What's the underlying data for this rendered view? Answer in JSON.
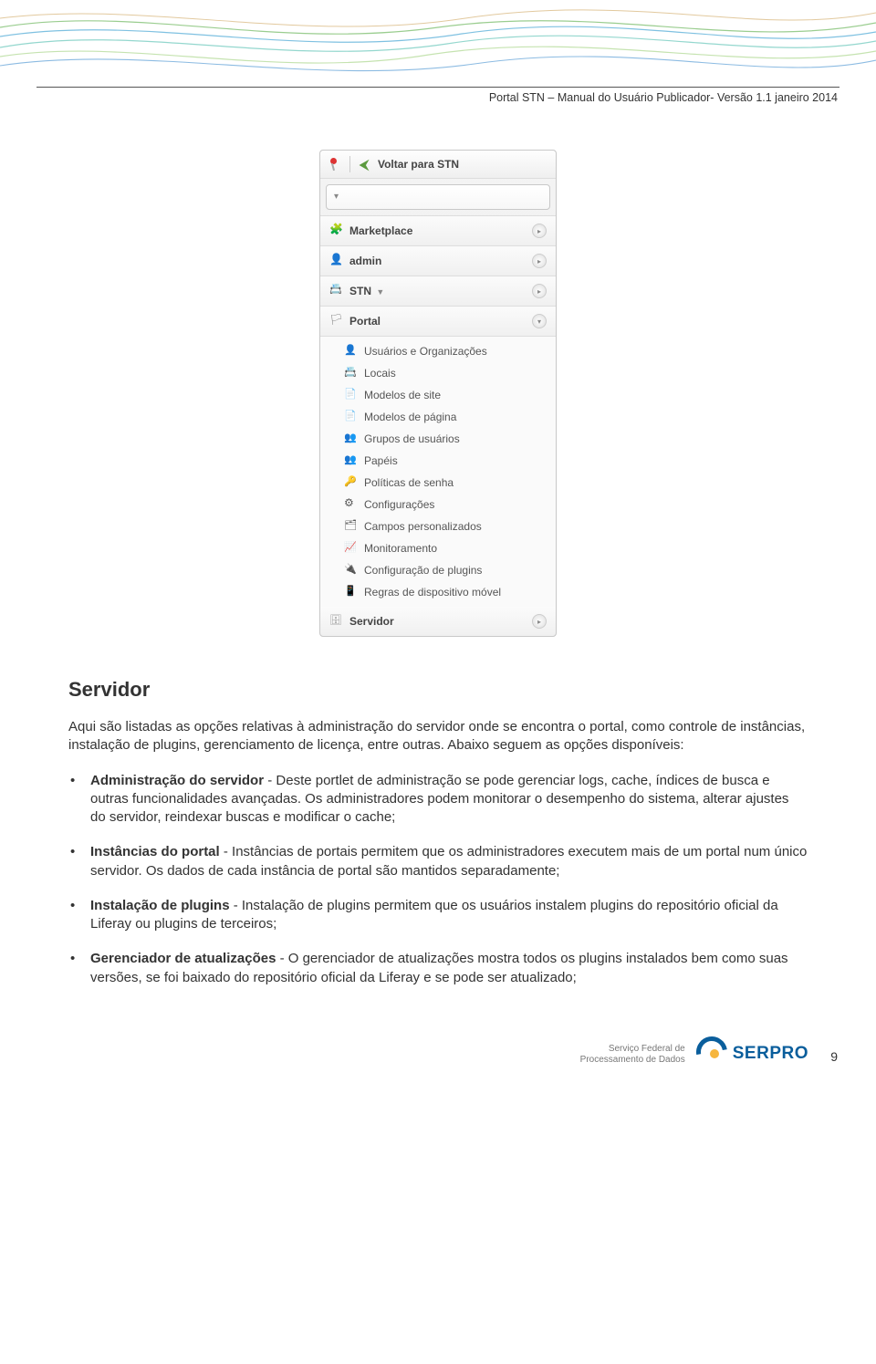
{
  "header": {
    "doc_title": "Portal STN – Manual do Usuário Publicador- Versão 1.1 janeiro 2014"
  },
  "panel": {
    "back_label": "Voltar para STN",
    "sections": {
      "marketplace": {
        "label": "Marketplace"
      },
      "admin": {
        "label": "admin"
      },
      "stn": {
        "label": "STN",
        "dropdown": "▼"
      },
      "portal": {
        "label": "Portal"
      },
      "servidor": {
        "label": "Servidor"
      }
    },
    "portal_items": [
      "Usuários e Organizações",
      "Locais",
      "Modelos de site",
      "Modelos de página",
      "Grupos de usuários",
      "Papéis",
      "Políticas de senha",
      "Configurações",
      "Campos personalizados",
      "Monitoramento",
      "Configuração de plugins",
      "Regras de dispositivo móvel"
    ]
  },
  "body": {
    "heading": "Servidor",
    "intro": "Aqui são listadas as opções relativas à administração do servidor onde se encontra o portal, como controle de instâncias, instalação de plugins, gerenciamento de licença, entre outras. Abaixo seguem as opções disponíveis:",
    "items": [
      {
        "title": "Administração do servidor",
        "text": " - Deste portlet de administração se pode gerenciar logs, cache, índices de busca e outras funcionalidades avançadas. Os administradores podem monitorar o desempenho do sistema, alterar ajustes do servidor, reindexar buscas e modificar o cache;"
      },
      {
        "title": "Instâncias do portal",
        "text": " - Instâncias de portais permitem que os administradores executem mais de um portal num único servidor. Os dados de cada instância de portal são mantidos separadamente;"
      },
      {
        "title": "Instalação de plugins",
        "text": " - Instalação de plugins permitem que os usuários instalem plugins do repositório oficial da Liferay ou plugins de terceiros;"
      },
      {
        "title": "Gerenciador de atualizações",
        "text": " - O gerenciador de atualizações mostra todos os plugins instalados bem como suas versões, se foi baixado do repositório oficial da Liferay e se pode ser atualizado;"
      }
    ]
  },
  "footer": {
    "label_line1": "Serviço Federal de",
    "label_line2": "Processamento de Dados",
    "brand": "SERPRO",
    "page": "9"
  }
}
